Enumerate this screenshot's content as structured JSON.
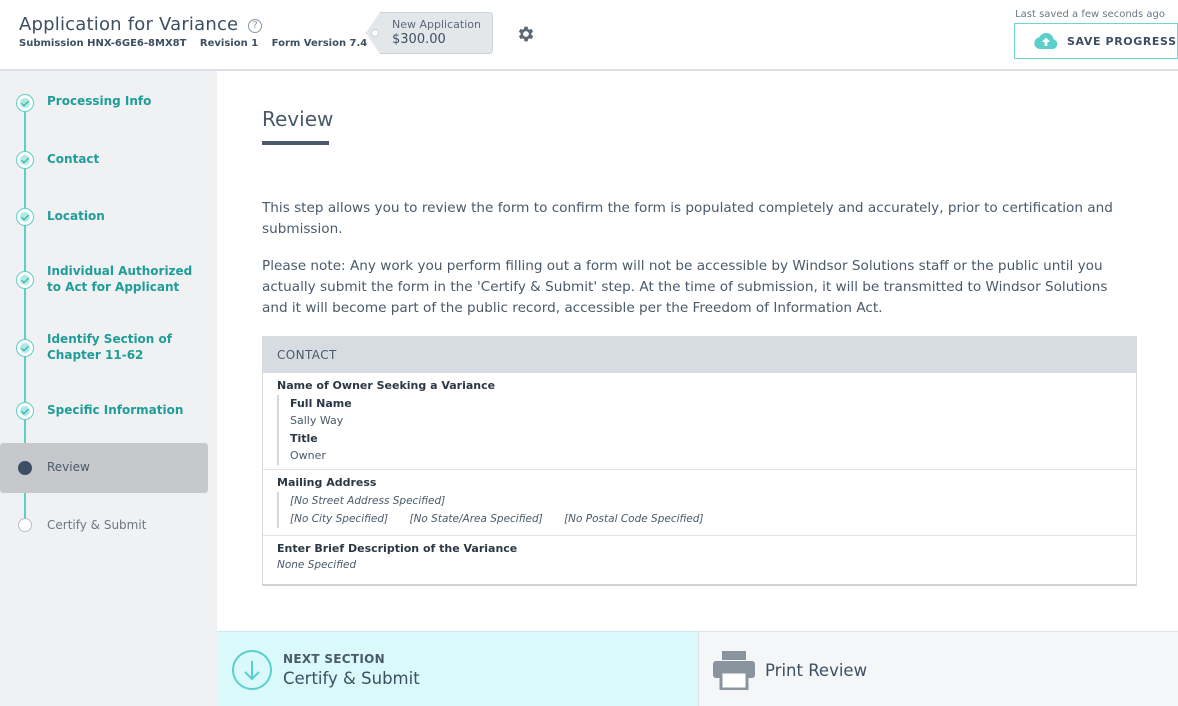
{
  "header": {
    "title": "Application for Variance",
    "help_icon": "?",
    "submission_label": "Submission",
    "submission_id": "HNX-6GE6-8MX8T",
    "revision": "Revision 1",
    "form_version": "Form Version 7.4",
    "price_tag": {
      "label": "New Application",
      "value": "$300.00"
    },
    "last_saved": "Last saved a few seconds ago",
    "save_button": "SAVE PROGRESS"
  },
  "sidebar": {
    "steps": [
      {
        "label": "Processing Info",
        "state": "complete"
      },
      {
        "label": "Contact",
        "state": "complete"
      },
      {
        "label": "Location",
        "state": "complete"
      },
      {
        "label_line1": "Individual Authorized",
        "label_line2": "to Act for Applicant",
        "state": "complete"
      },
      {
        "label_line1": "Identify Section of",
        "label_line2": "Chapter 11-62",
        "state": "complete"
      },
      {
        "label": "Specific Information",
        "state": "complete"
      },
      {
        "label": "Review",
        "state": "current"
      },
      {
        "label": "Certify & Submit",
        "state": "future"
      }
    ]
  },
  "main": {
    "title": "Review",
    "paragraph1": "This step allows you to review the form to confirm the form is populated completely and accurately, prior to certification and submission.",
    "paragraph2": "Please note: Any work you perform filling out a form will not be accessible by Windsor Solutions staff or the public until you actually submit the form in the 'Certify & Submit' step. At the time of submission, it will be transmitted to Windsor Solutions and it will become part of the public record, accessible per the Freedom of Information Act.",
    "card": {
      "header": "CONTACT",
      "sections": {
        "owner": {
          "title": "Name of Owner Seeking a Variance",
          "full_name_label": "Full Name",
          "full_name_value": "Sally Way",
          "title_label": "Title",
          "title_value": "Owner"
        },
        "mailing": {
          "title": "Mailing Address",
          "street": "[No Street Address Specified]",
          "city": "[No City Specified]",
          "state": "[No State/Area Specified]",
          "postal": "[No Postal Code Specified]"
        },
        "description": {
          "title": "Enter Brief Description of the Variance",
          "value": "None Specified"
        }
      }
    }
  },
  "footer": {
    "next_small": "NEXT SECTION",
    "next_big": "Certify & Submit",
    "print_label": "Print Review"
  },
  "colors": {
    "accent": "#5ccfcb",
    "accent_text": "#1f9d99",
    "text_dark": "#3d4f63",
    "card_header_bg": "#d7dce2",
    "next_bg": "#d9f9fb"
  }
}
